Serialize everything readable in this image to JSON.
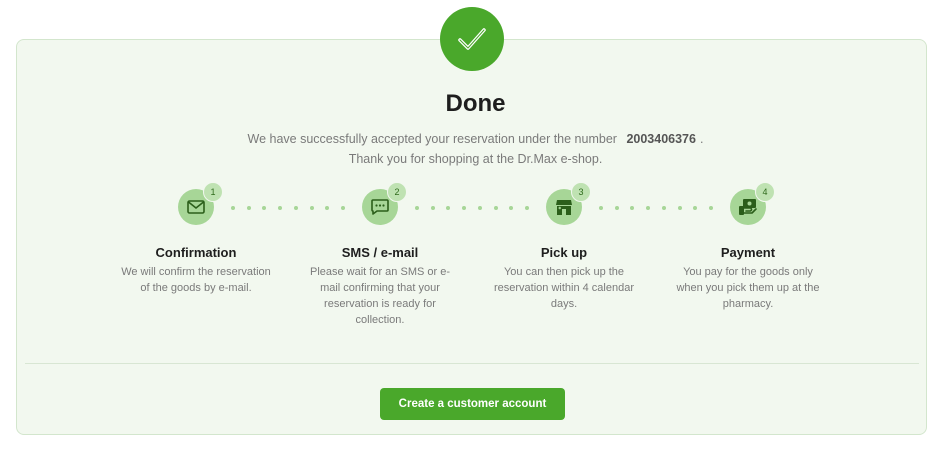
{
  "header": {
    "title": "Done",
    "message_prefix": "We have successfully accepted your reservation under the number",
    "reservation_number": "2003406376",
    "message_suffix": ".",
    "thanks": "Thank you for shopping at the Dr.Max e-shop."
  },
  "steps": [
    {
      "number": "1",
      "icon": "envelope-icon",
      "title": "Confirmation",
      "description": "We will confirm the reservation of the goods by e-mail."
    },
    {
      "number": "2",
      "icon": "chat-icon",
      "title": "SMS / e-mail",
      "description": "Please wait for an SMS or e-mail confirming that your reservation is ready for collection."
    },
    {
      "number": "3",
      "icon": "store-icon",
      "title": "Pick up",
      "description": "You can then pick up the reservation within 4 calendar days."
    },
    {
      "number": "4",
      "icon": "cash-icon",
      "title": "Payment",
      "description": "You pay for the goods only when you pick them up at the pharmacy."
    }
  ],
  "actions": {
    "create_account": "Create a customer account"
  },
  "colors": {
    "accent": "#4aa82b",
    "card_bg": "#f2f8ef",
    "step_icon_bg": "#a7d697"
  }
}
